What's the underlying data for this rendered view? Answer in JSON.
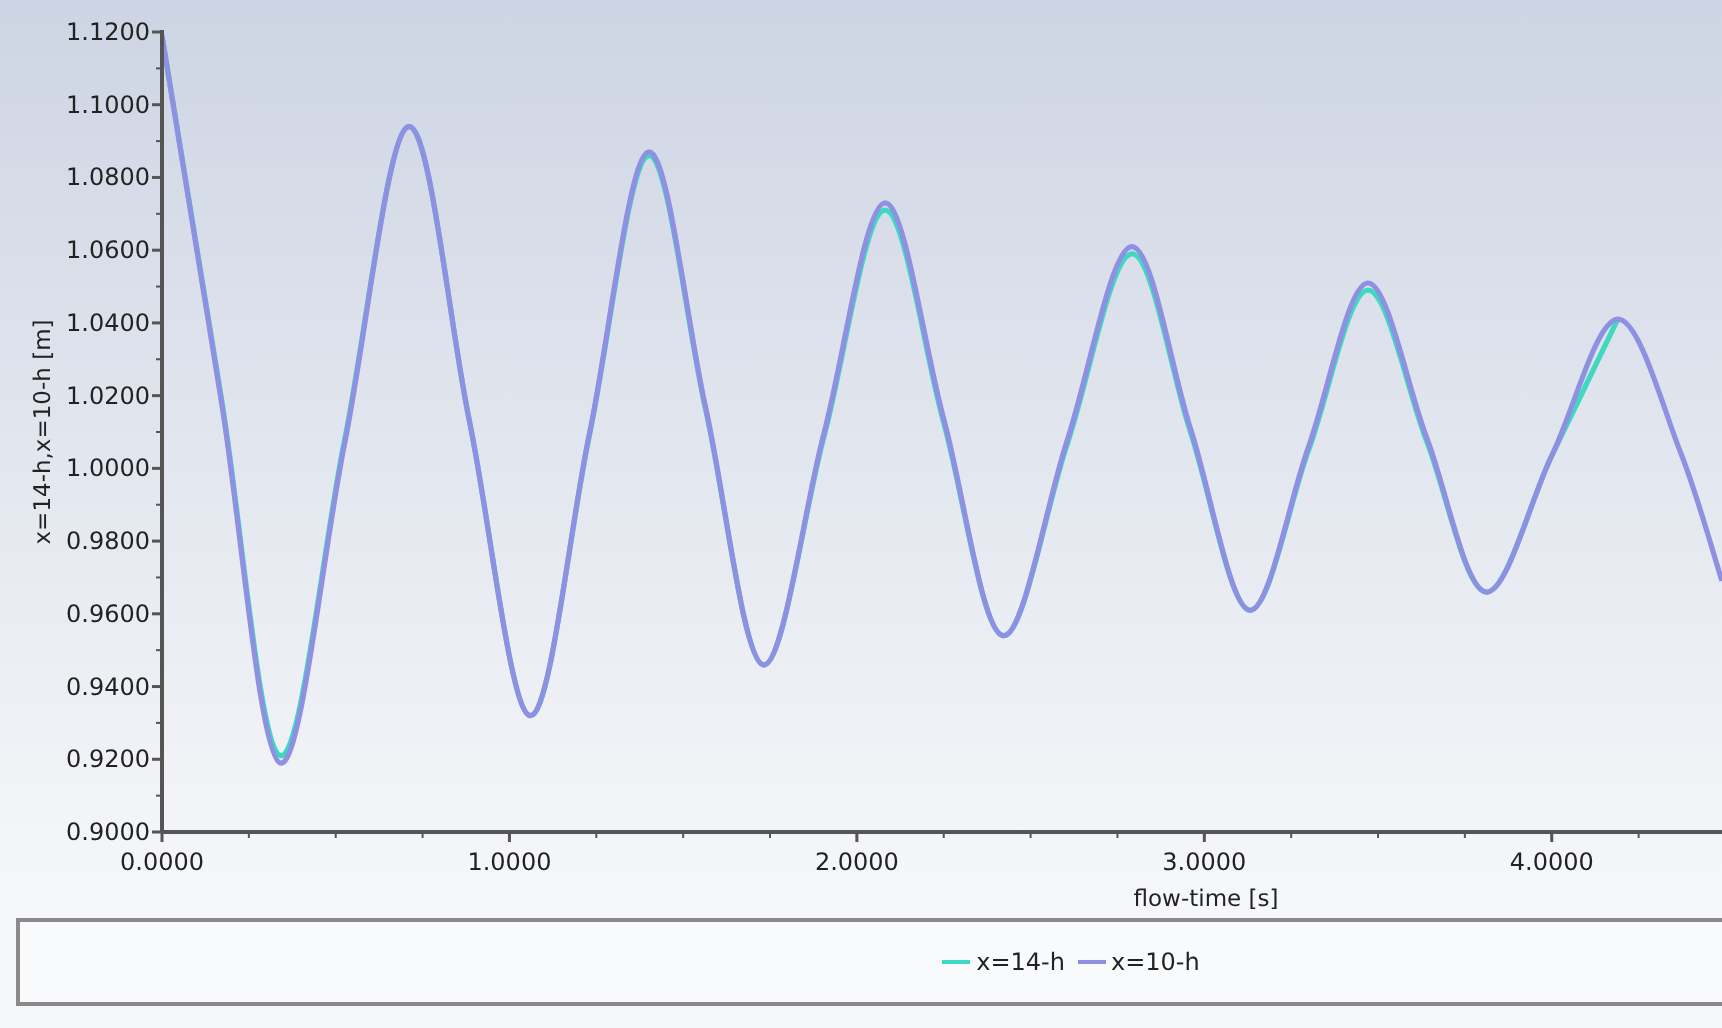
{
  "plot": {
    "chart_data": {
      "type": "line",
      "xlabel": "flow-time [s]",
      "ylabel": "x=14-h,x=10-h [m]",
      "x": [
        0,
        0.17,
        0.34,
        0.525,
        0.71,
        0.885,
        1.06,
        1.23,
        1.4,
        1.565,
        1.73,
        1.905,
        2.08,
        2.25,
        2.42,
        2.605,
        2.79,
        2.96,
        3.13,
        3.3,
        3.47,
        3.64,
        3.81,
        4.0,
        4.19,
        4.37,
        4.49
      ],
      "series": [
        {
          "name": "x=14-h",
          "color": "#3fd9c2",
          "values": [
            1.119,
            1.02,
            0.921,
            1.0075,
            1.094,
            1.013,
            0.932,
            1.009,
            1.086,
            1.016,
            0.946,
            1.0085,
            1.071,
            1.0125,
            0.954,
            1.0065,
            1.059,
            1.01,
            0.961,
            1.005,
            1.049,
            1.0075,
            0.966,
            1.0035,
            1.041,
            null,
            null
          ]
        },
        {
          "name": "x=10-h",
          "color": "#8e90e2",
          "values": [
            1.119,
            1.019,
            0.919,
            1.0065,
            1.094,
            1.013,
            0.932,
            1.0095,
            1.087,
            1.0165,
            0.946,
            1.0095,
            1.073,
            1.0135,
            0.954,
            1.0075,
            1.061,
            1.011,
            0.961,
            1.006,
            1.051,
            1.0085,
            0.966,
            1.0035,
            1.041,
            1.0045,
            0.969
          ]
        }
      ],
      "xlim": [
        0,
        4.49
      ],
      "ylim": [
        0.9,
        1.12
      ],
      "xticks": [
        {
          "value": 0,
          "label": "0.0000"
        },
        {
          "value": 1,
          "label": "1.0000"
        },
        {
          "value": 2,
          "label": "2.0000"
        },
        {
          "value": 3,
          "label": "3.0000"
        },
        {
          "value": 4,
          "label": "4.0000"
        }
      ],
      "yticks": [
        {
          "value": 0.9,
          "label": "0.9000"
        },
        {
          "value": 0.92,
          "label": "0.9200"
        },
        {
          "value": 0.94,
          "label": "0.9400"
        },
        {
          "value": 0.96,
          "label": "0.9600"
        },
        {
          "value": 0.98,
          "label": "0.9800"
        },
        {
          "value": 1.0,
          "label": "1.0000"
        },
        {
          "value": 1.02,
          "label": "1.0200"
        },
        {
          "value": 1.04,
          "label": "1.0400"
        },
        {
          "value": 1.06,
          "label": "1.0600"
        },
        {
          "value": 1.08,
          "label": "1.0800"
        },
        {
          "value": 1.1,
          "label": "1.1000"
        },
        {
          "value": 1.12,
          "label": "1.1200"
        }
      ]
    }
  }
}
